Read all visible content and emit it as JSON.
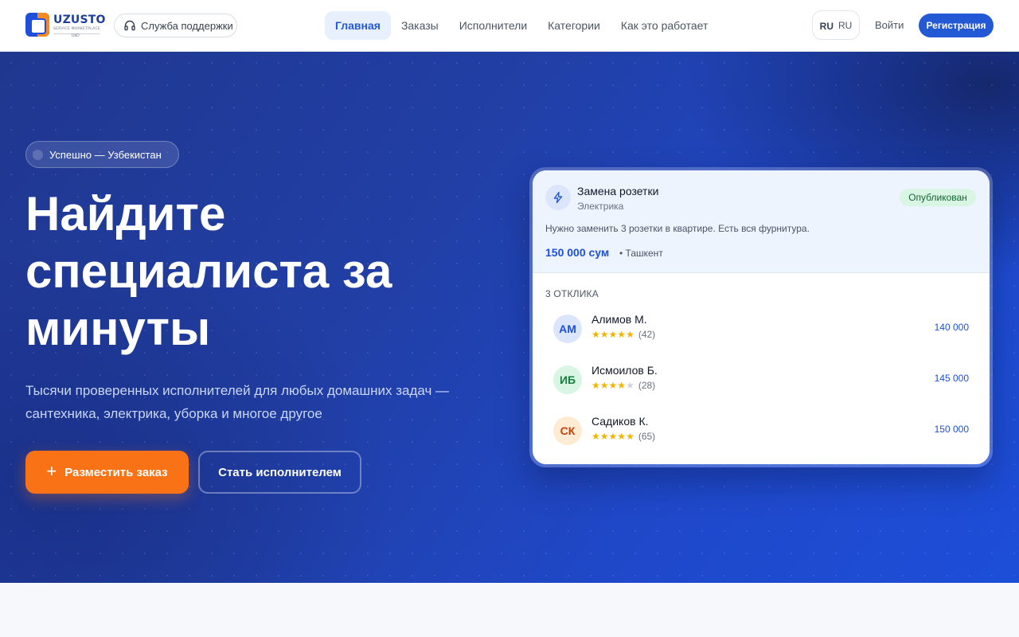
{
  "brand": {
    "name": "UZUSTO",
    "tagline": "SERVICE MARKETPLACE",
    "small": "UxD",
    "colors": {
      "primary": "#2459d6",
      "accent": "#f97316"
    }
  },
  "header": {
    "support_label": "Служба поддержки",
    "support_icon": "headset-icon",
    "nav": [
      {
        "label": "Главная",
        "active": true
      },
      {
        "label": "Заказы",
        "active": false
      },
      {
        "label": "Исполнители",
        "active": false
      },
      {
        "label": "Категории",
        "active": false
      },
      {
        "label": "Как это работает",
        "active": false
      }
    ],
    "lang_flag": "RU",
    "lang_code": "RU",
    "login_label": "Войти",
    "register_label": "Регистрация"
  },
  "hero": {
    "badge": "Успешно — Узбекистан",
    "title_lines": [
      "Найдите",
      "специалиста за",
      "минуты"
    ],
    "subtitle_line1": "Тысячи проверенных исполнителей для любых домашних задач —",
    "subtitle_line2": "сантехника, электрика, уборка и многое другое",
    "primary_button": "Разместить заказ",
    "secondary_button": "Стать исполнителем"
  },
  "card": {
    "task_icon": "lightning-icon",
    "task_title": "Замена розетки",
    "task_category": "Электрика",
    "status": "Опубликован",
    "description": "Нужно заменить 3 розетки в квартире. Есть вся фурнитура.",
    "price": "150 000 сум",
    "city": "• Ташкент",
    "responses_title": "3 ОТКЛИКА",
    "responses": [
      {
        "initials": "АМ",
        "name": "Алимов М.",
        "rating": 5,
        "reviews": "(42)",
        "price": "140 000",
        "avatar_bg": "#dbe6fc",
        "avatar_fg": "#1e4fd8"
      },
      {
        "initials": "ИБ",
        "name": "Исмоилов Б.",
        "rating": 4,
        "reviews": "(28)",
        "price": "145 000",
        "avatar_bg": "#d8f6e3",
        "avatar_fg": "#15803d"
      },
      {
        "initials": "СК",
        "name": "Садиков К.",
        "rating": 5,
        "reviews": "(65)",
        "price": "150 000",
        "avatar_bg": "#fdebd3",
        "avatar_fg": "#c2410c"
      }
    ]
  }
}
